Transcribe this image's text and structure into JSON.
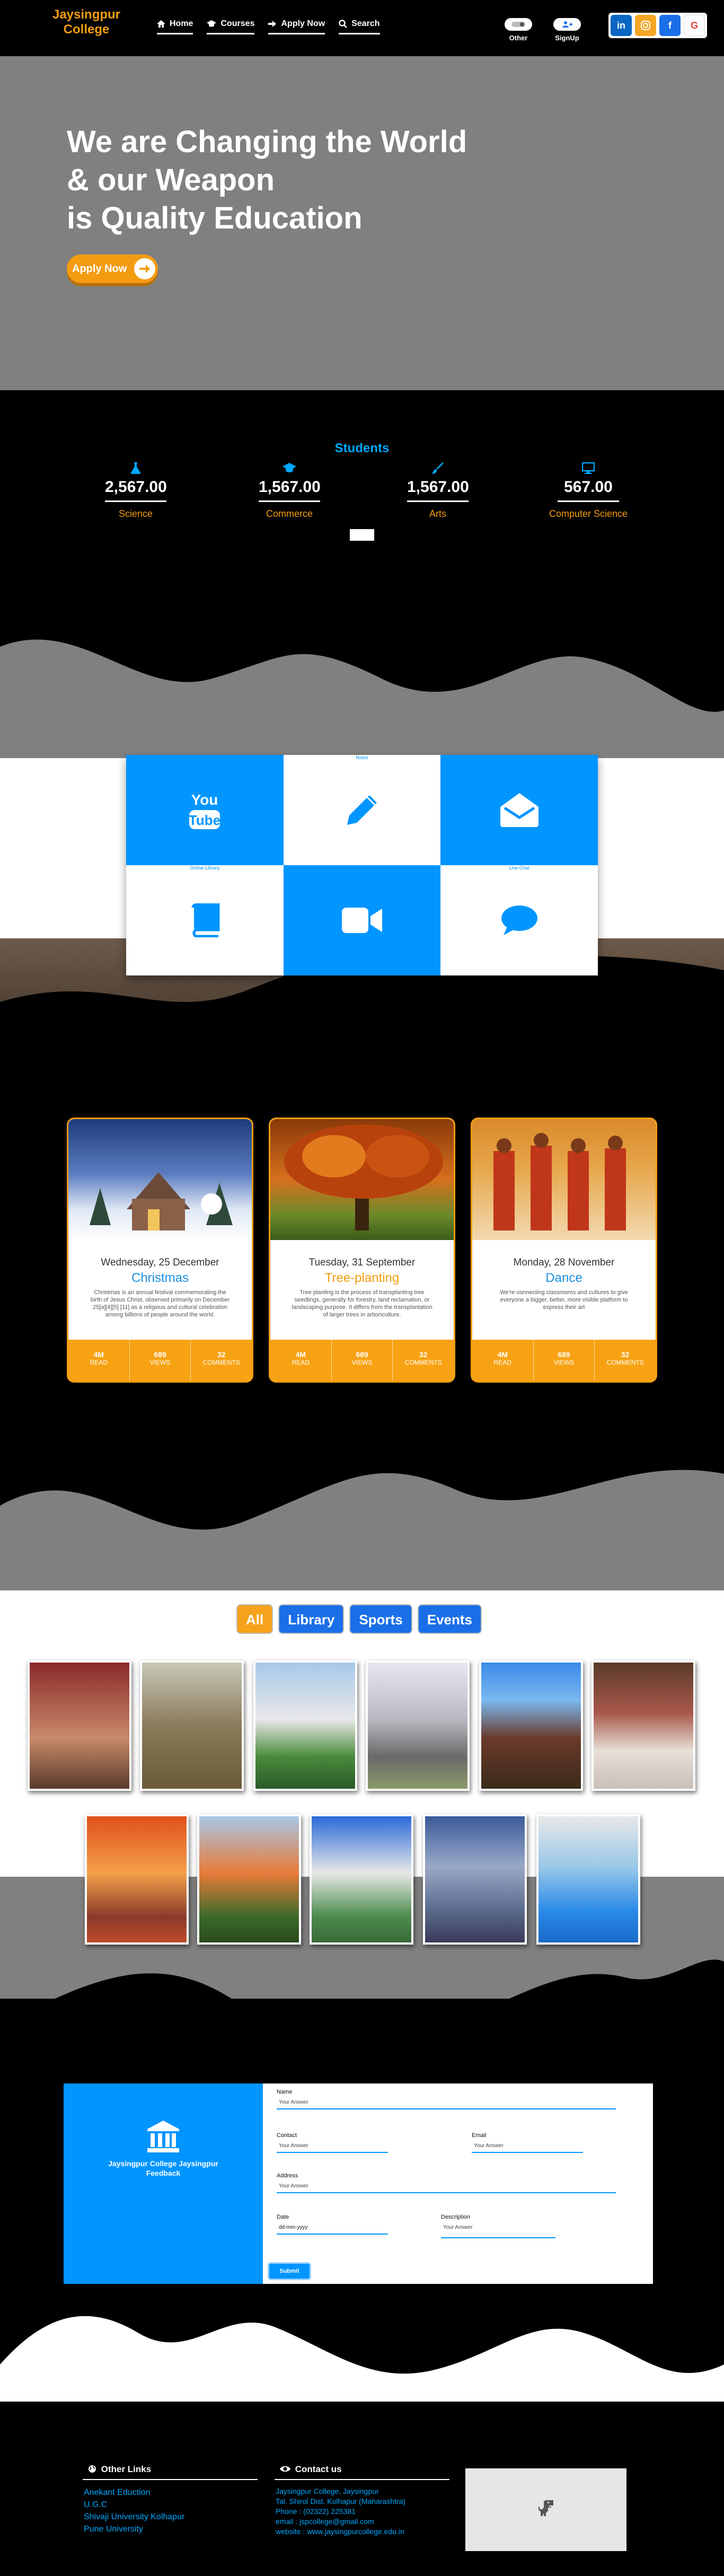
{
  "nav": {
    "logo_line1": "Jaysingpur",
    "logo_line2": "College",
    "links": [
      {
        "icon": "home-icon",
        "label": "Home"
      },
      {
        "icon": "grad-cap-icon",
        "label": "Courses"
      },
      {
        "icon": "sign-in-icon",
        "label": "Apply Now"
      },
      {
        "icon": "search-icon",
        "label": "Search"
      }
    ],
    "other_label": "Other",
    "signup_label": "SignUp",
    "socials": [
      "linkedin",
      "instagram",
      "facebook",
      "google"
    ]
  },
  "hero": {
    "line1": "We are Changing the World",
    "line2": "& our Weapon",
    "line3": "is Quality Education",
    "apply_label": "Apply Now"
  },
  "stats": {
    "title": "Students",
    "items": [
      {
        "value": "2,567.00",
        "label": "Science",
        "icon": "flask-icon"
      },
      {
        "value": "1,567.00",
        "label": "Commerce",
        "icon": "grad-cap-icon"
      },
      {
        "value": "1,567.00",
        "label": "Arts",
        "icon": "brush-icon"
      },
      {
        "value": "567.00",
        "label": "Computer Science",
        "icon": "monitor-icon"
      }
    ]
  },
  "features": {
    "cells": [
      {
        "caption": "",
        "icon": "youtube-icon",
        "color": "#0095ff"
      },
      {
        "caption": "Notes",
        "icon": "pencil-icon",
        "color": "#ffffff"
      },
      {
        "caption": "",
        "icon": "envelope-icon",
        "color": "#0095ff"
      },
      {
        "caption": "Online Library",
        "icon": "book-icon",
        "color": "#ffffff"
      },
      {
        "caption": "",
        "icon": "video-camera-icon",
        "color": "#0095ff"
      },
      {
        "caption": "Live Chat",
        "icon": "chat-icon",
        "color": "#ffffff"
      }
    ]
  },
  "events": [
    {
      "date": "Wednesday, 25 December",
      "title": "Christmas",
      "title_color": "#1a8fe0",
      "desc": "Christmas is an annual festival commemorating the birth of Jesus Christ, observed primarily on December 25[a][4][5] [11] as a religious and cultural celebration among billions of people around the world.",
      "stats": [
        {
          "value": "4M",
          "label": "READ"
        },
        {
          "value": "689",
          "label": "VIEWS"
        },
        {
          "value": "32",
          "label": "COMMENTS"
        }
      ]
    },
    {
      "date": "Tuesday, 31 September",
      "title": "Tree-planting",
      "title_color": "#f39c12",
      "desc": "Tree planting is the process of transplanting tree seedlings, generally for forestry, land reclamation, or landscaping purpose. It differs from the transplantation of larger trees in arboriculture.",
      "stats": [
        {
          "value": "4M",
          "label": "READ"
        },
        {
          "value": "689",
          "label": "VIEWS"
        },
        {
          "value": "32",
          "label": "COMMENTS"
        }
      ]
    },
    {
      "date": "Monday, 28 November",
      "title": "Dance",
      "title_color": "#1a8fe0",
      "desc": "We're connecting classrooms and cultures to give everyone a bigger, better, more visible platform to express their art",
      "stats": [
        {
          "value": "4M",
          "label": "READ"
        },
        {
          "value": "689",
          "label": "VIEWS"
        },
        {
          "value": "32",
          "label": "COMMENTS"
        }
      ]
    }
  ],
  "gallery": {
    "filters": [
      "All",
      "Library",
      "Sports",
      "Events"
    ],
    "active": "All"
  },
  "feedback": {
    "title_line1": "Jaysingpur College Jaysingpur",
    "title_line2": "Feedback",
    "name_label": "Name",
    "name_placeholder": "Your Answer",
    "contact_label": "Contact",
    "contact_placeholder": "Your Answer",
    "email_label": "Email",
    "email_placeholder": "Your Answer",
    "address_label": "Address",
    "address_placeholder": "Your Answer",
    "date_label": "Date",
    "date_placeholder": "dd-mm-yyyy",
    "description_label": "Description",
    "description_placeholder": "Your Answer",
    "submit_label": "Submit"
  },
  "footer": {
    "links_title": "Other Links",
    "links": [
      "Anekant Eduction",
      "U.G.C",
      "Shivaji University Kolhapur",
      "Pune University"
    ],
    "contact_title": "Contact us",
    "contact_lines": [
      "Jaysingpur College, Jaysingpur",
      "Tal. Shirol Dist. Kolhapur (Maharashtra)",
      "Phone : (02322) 225381",
      "email : jspcollege@gmail.com",
      "website : www.jaysingpurcollege.edu.in"
    ]
  }
}
